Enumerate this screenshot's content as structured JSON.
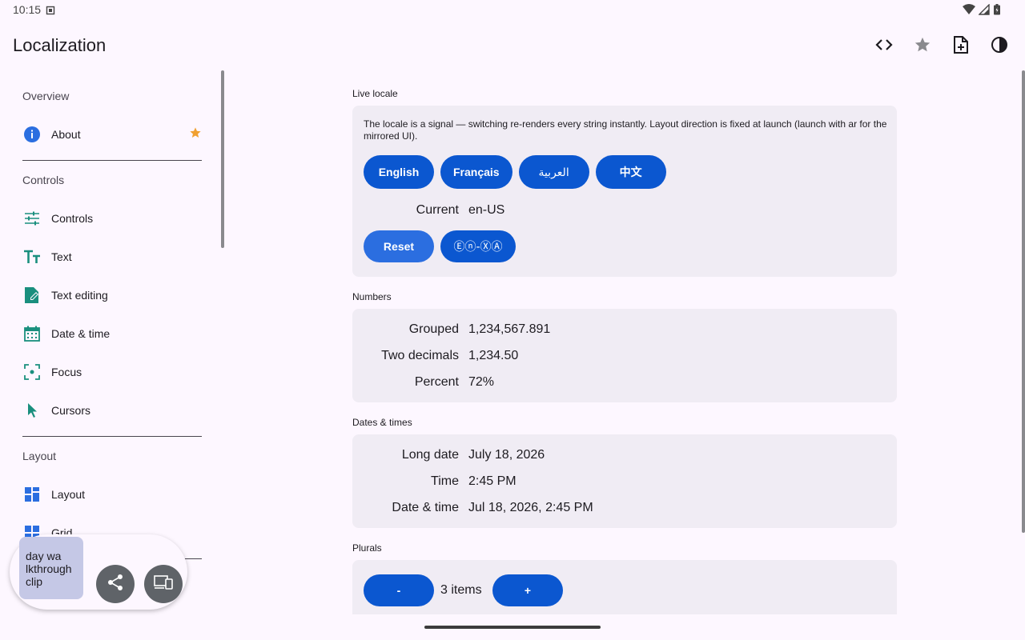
{
  "status_bar": {
    "time": "10:15"
  },
  "app": {
    "title": "Localization"
  },
  "sidebar": {
    "sections": [
      {
        "title": "Overview",
        "items": [
          {
            "label": "About",
            "icon": "info-icon",
            "starred": true
          }
        ]
      },
      {
        "title": "Controls",
        "items": [
          {
            "label": "Controls",
            "icon": "tune-icon"
          },
          {
            "label": "Text",
            "icon": "text-fields-icon"
          },
          {
            "label": "Text editing",
            "icon": "edit-document-icon"
          },
          {
            "label": "Date & time",
            "icon": "calendar-icon"
          },
          {
            "label": "Focus",
            "icon": "focus-frame-icon"
          },
          {
            "label": "Cursors",
            "icon": "cursor-arrow-icon"
          }
        ]
      },
      {
        "title": "Layout",
        "items": [
          {
            "label": "Layout",
            "icon": "dashboard-icon"
          },
          {
            "label": "Grid",
            "icon": "grid-icon"
          }
        ]
      }
    ]
  },
  "live_locale": {
    "label": "Live locale",
    "description": "The locale is a signal — switching re-renders every string instantly. Layout direction is fixed at launch (launch with ar for the mirrored UI).",
    "buttons": [
      "English",
      "Français",
      "العربية",
      "中文"
    ],
    "current_key": "Current",
    "current_value": "en-US",
    "reset_label": "Reset",
    "pseudo_label": "Ⓔⓝ-ⓍⒶ"
  },
  "numbers": {
    "label": "Numbers",
    "rows": [
      {
        "key": "Grouped",
        "value": "1,234,567.891"
      },
      {
        "key": "Two decimals",
        "value": "1,234.50"
      },
      {
        "key": "Percent",
        "value": "72%"
      }
    ]
  },
  "dates": {
    "label": "Dates & times",
    "rows": [
      {
        "key": "Long date",
        "value": "July 18, 2026"
      },
      {
        "key": "Time",
        "value": "2:45 PM"
      },
      {
        "key": "Date & time",
        "value": "Jul 18, 2026, 2:45 PM"
      }
    ]
  },
  "plurals": {
    "label": "Plurals",
    "minus_label": "-",
    "count_text": "3 items",
    "plus_label": "+"
  },
  "floating_toolbar": {
    "clip_text": "day wa lkthrough clip"
  },
  "colors": {
    "accent": "#0b57d0",
    "icon_teal": "#1a8f7e",
    "star": "#f0a030"
  }
}
